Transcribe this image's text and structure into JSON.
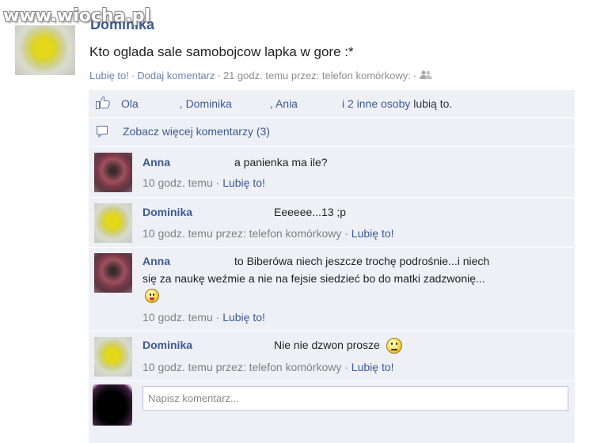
{
  "watermark": "www.wiocha.pl",
  "post": {
    "author": "Dominika",
    "status": "Kto oglada sale samobojcow lapka w gore :*",
    "like_link": "Lubię to!",
    "comment_link": "Dodaj komentarz",
    "timestamp": "21 godz. temu przez: telefon komórkowy:"
  },
  "likes": {
    "name1": "Ola",
    "name2": ", Dominika",
    "name3": ", Ania",
    "others": "i 2 inne osoby",
    "suffix": "lubią to."
  },
  "more_comments": "Zobacz więcej komentarzy (3)",
  "comments": [
    {
      "author": "Anna",
      "text": "a panienka ma ile?",
      "time": "10 godz. temu",
      "like": "Lubię to!"
    },
    {
      "author": "Dominika",
      "text": "Eeeeee...13 ;p",
      "time": "10 godz. temu przez: telefon komórkowy",
      "like": "Lubię to!"
    },
    {
      "author": "Anna",
      "text_line1": "to Biberówa niech jeszcze trochę podrośnie...i niech",
      "text_line2": "się za naukę weźmie a nie na fejsie siedzieć bo do matki zadzwonię...",
      "time": "10 godz. temu",
      "like": "Lubię to!"
    },
    {
      "author": "Dominika",
      "text": "Nie nie dzwon prosze",
      "time": "10 godz. temu przez: telefon komórkowy",
      "like": "Lubię to!"
    }
  ],
  "comment_input": {
    "placeholder": "Napisz komentarz..."
  },
  "colors": {
    "link": "#3b5998",
    "panel": "#eef0f6",
    "meta": "#808080"
  },
  "icons": [
    "thumbs-up-icon",
    "comment-bubble-icon",
    "people-icon",
    "smiley-tongue-icon",
    "smiley-worried-icon"
  ]
}
